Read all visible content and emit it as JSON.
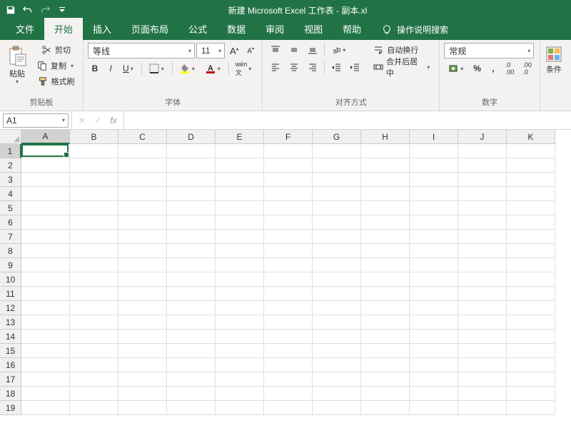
{
  "title": "新建 Microsoft Excel 工作表 - 副本.xl",
  "tabs": [
    "文件",
    "开始",
    "插入",
    "页面布局",
    "公式",
    "数据",
    "审阅",
    "视图",
    "帮助"
  ],
  "active_tab_index": 1,
  "tellme": "操作说明搜索",
  "clipboard": {
    "label": "剪贴板",
    "paste": "粘贴",
    "cut": "剪切",
    "copy": "复制",
    "format_painter": "格式刷"
  },
  "font": {
    "label": "字体",
    "name": "等线",
    "size": "11",
    "bold": "B",
    "italic": "I",
    "underline": "U"
  },
  "align": {
    "label": "对齐方式",
    "wrap": "自动换行",
    "merge": "合并后居中"
  },
  "number": {
    "label": "数字",
    "format": "常规"
  },
  "cond_format": "条件",
  "namebox": "A1",
  "fx": "fx",
  "columns": [
    "A",
    "B",
    "C",
    "D",
    "E",
    "F",
    "G",
    "H",
    "I",
    "J",
    "K"
  ],
  "rows": [
    1,
    2,
    3,
    4,
    5,
    6,
    7,
    8,
    9,
    10,
    11,
    12,
    13,
    14,
    15,
    16,
    17,
    18,
    19
  ],
  "selected_col_index": 0,
  "selected_row_index": 0
}
